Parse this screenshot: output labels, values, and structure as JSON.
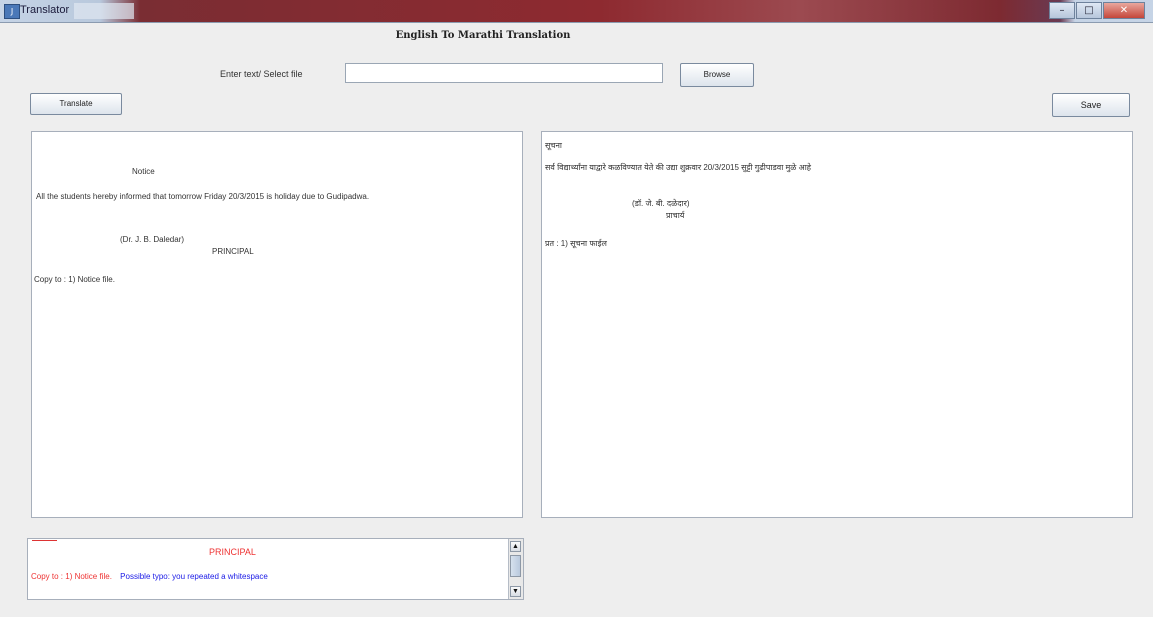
{
  "window": {
    "title": "Translator",
    "controls": {
      "minimize": "–",
      "maximize": "□",
      "close": "✕"
    }
  },
  "app_title": "English To Marathi Translation",
  "input": {
    "label": "Enter text/ Select file",
    "value": "",
    "browse_label": "Browse"
  },
  "toolbar": {
    "translate_label": "Translate",
    "save_label": "Save"
  },
  "source_text": {
    "lines": [
      "Notice",
      "All the students hereby informed that tomorrow Friday 20/3/2015 is holiday due to Gudipadwa.",
      "(Dr. J. B. Daledar)",
      "PRINCIPAL",
      "Copy to :  1) Notice file."
    ]
  },
  "translated_text": {
    "lines": [
      "सूचना",
      "सर्व विद्यार्थ्यांना याद्वारे कळविण्यात येते की उद्या शुक्रवार 20/3/2015 सुट्टी गुढीपाडवा मुळे आहे",
      "(डॉ. जे. बी. दळेदार)",
      "प्राचार्य",
      "प्रत :  1) सूचना फाईल"
    ]
  },
  "error_panel": {
    "line1": "PRINCIPAL",
    "line2_prefix": "Copy to :  1) Notice file.",
    "line2_message": "Possible typo: you repeated a whitespace",
    "colors": {
      "error": "#e33333",
      "message": "#1a1ae6"
    }
  }
}
